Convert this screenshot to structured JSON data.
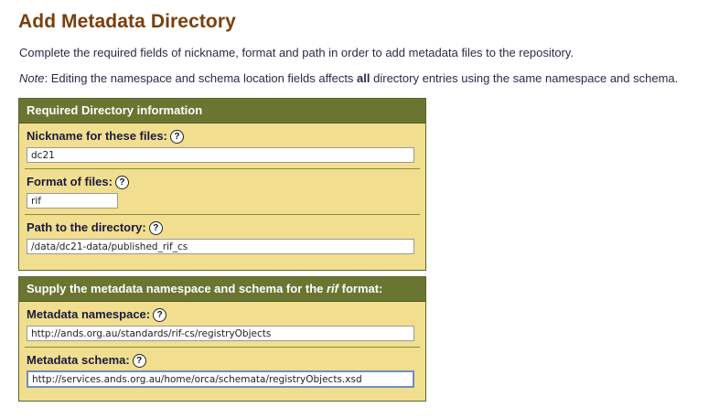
{
  "page": {
    "title": "Add Metadata Directory",
    "intro": "Complete the required fields of nickname, format and path in order to add metadata files to the repository.",
    "note_label": "Note",
    "note_text_before": ": Editing the namespace and schema location fields affects ",
    "note_bold": "all",
    "note_text_after": " directory entries using the same namespace and schema."
  },
  "directory_panel": {
    "header": "Required Directory information",
    "fields": [
      {
        "label": "Nickname for these files:",
        "value": "dc21"
      },
      {
        "label": "Format of files:",
        "value": "rif"
      },
      {
        "label": "Path to the directory:",
        "value": "/data/dc21-data/published_rif_cs"
      }
    ]
  },
  "schema_panel": {
    "header_before": "Supply the metadata namespace and schema for the ",
    "header_format": "rif",
    "header_after": " format:",
    "fields": [
      {
        "label": "Metadata namespace:",
        "value": "http://ands.org.au/standards/rif-cs/registryObjects"
      },
      {
        "label": "Metadata schema:",
        "value": "http://services.ands.org.au/home/orca/schemata/registryObjects.xsd"
      }
    ]
  },
  "help_glyph": "?",
  "icons": {
    "help": "question-mark-circle-icon"
  },
  "colors": {
    "title": "#7a3e0a",
    "panel_header": "#6b7532",
    "panel_body": "#f2de8f"
  }
}
